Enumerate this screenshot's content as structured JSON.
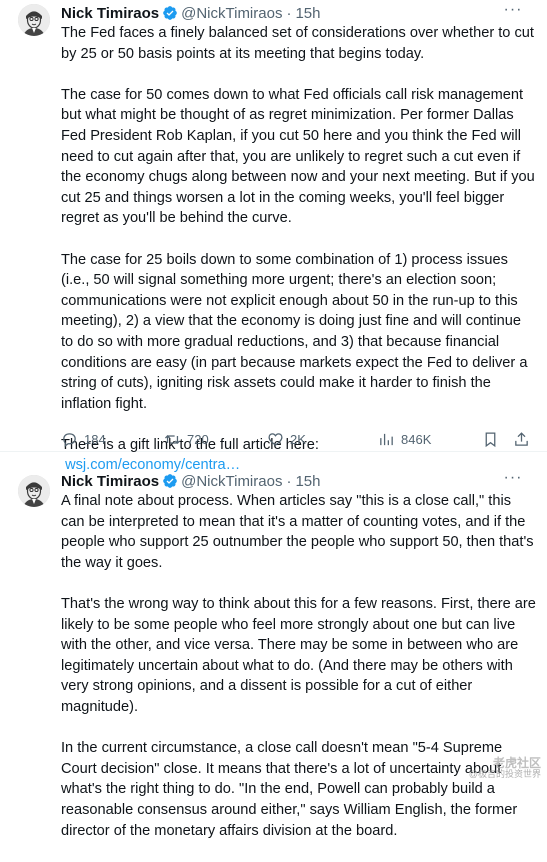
{
  "tweets": [
    {
      "author_name": "Nick Timiraos",
      "handle": "@NickTimiraos",
      "separator": "·",
      "time": "15h",
      "paragraphs": [
        "The Fed faces a finely balanced set of considerations over whether to cut by 25 or 50 basis points at its meeting that begins today.",
        "The case for 50 comes down to what Fed officials call risk management but what might be thought of as regret minimization. Per former Dallas Fed President Rob Kaplan, if you cut 50 here and you think the Fed will need to cut again after that, you are unlikely to regret such a cut even if the economy chugs along between now and your next meeting. But if you cut 25 and things worsen a lot in the coming weeks, you'll feel bigger regret as you'll be behind the curve.",
        "The case for 25 boils down to some combination of 1) process issues (i.e., 50 will signal something more urgent; there's an election soon; communications were not explicit enough about 50 in the run-up to this meeting), 2) a view that the economy is doing just fine and will continue to do so with more gradual reductions, and 3) that because financial conditions are easy (in part because markets expect the Fed to deliver a string of cuts), igniting risk assets could make it harder to finish the inflation fight.",
        "There is a gift link to the full article here:"
      ],
      "link_text": "wsj.com/economy/centra…",
      "stats": {
        "replies": "184",
        "reposts": "720",
        "likes": "2K",
        "views": "846K"
      }
    },
    {
      "author_name": "Nick Timiraos",
      "handle": "@NickTimiraos",
      "separator": "·",
      "time": "15h",
      "paragraphs": [
        "A final note about process. When articles say \"this is a close call,\" this can be interpreted to mean that it's a matter of counting votes, and if the people who support 25 outnumber the people who support 50, then that's the way it goes.",
        "That's the wrong way to think about this for a few reasons. First, there are likely to be some people who feel more strongly about one but can live with the other, and vice versa. There may be some in between who are legitimately uncertain about what to do. (And there may be others with very strong opinions, and a dissent is possible for a cut of either magnitude).",
        "In the current circumstance, a close call doesn't mean \"5-4 Supreme Court decision\" close. It means that there's a lot of uncertainty about what's the right thing to do. \"In the end, Powell can probably build a reasonable consensus around either,\" says William English, the former director of the monetary affairs division at the board."
      ]
    }
  ],
  "watermark": {
    "main": "老虎社区",
    "sub": "@极吉的投资世界"
  },
  "colors": {
    "text": "#0f1419",
    "secondary": "#536471",
    "link": "#1d9bf0",
    "verified": "#1d9bf0"
  }
}
